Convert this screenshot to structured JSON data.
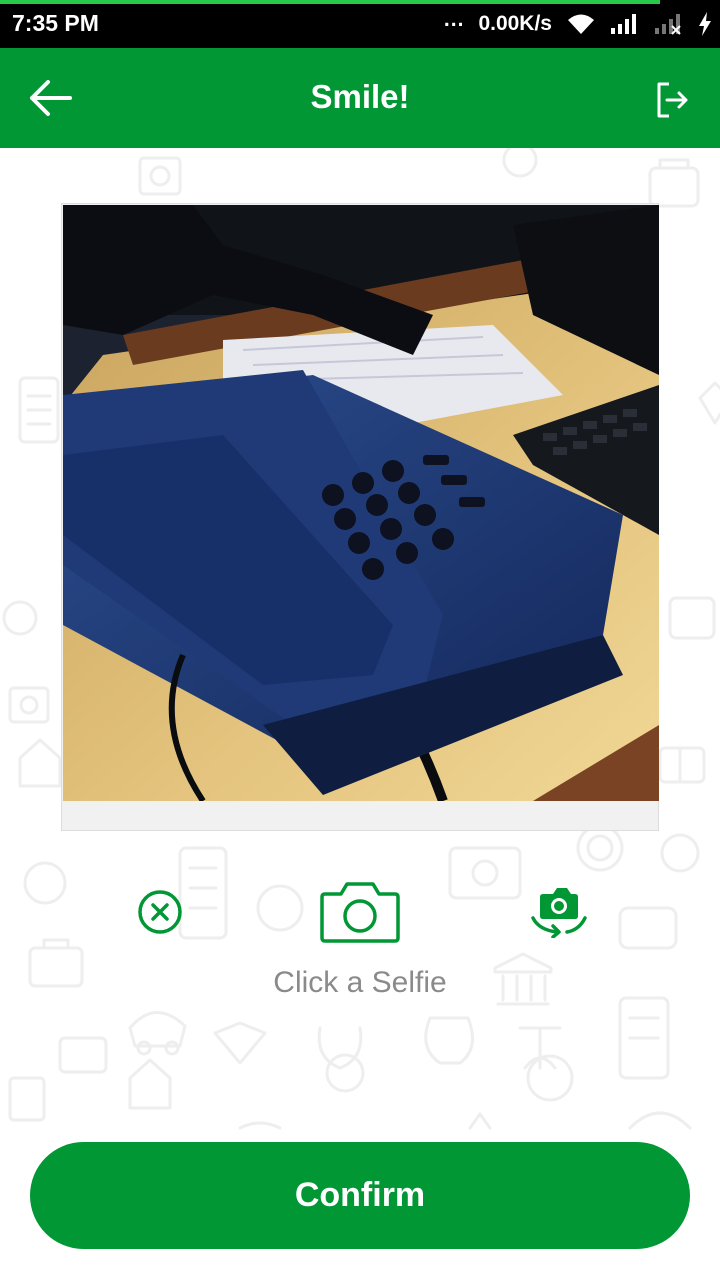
{
  "status_bar": {
    "time": "7:35 PM",
    "network_speed": "0.00K/s",
    "dots": "...",
    "icons": [
      "wifi-icon",
      "signal-icon",
      "signal-no-sim-icon",
      "charging-icon"
    ]
  },
  "app_bar": {
    "title": "Smile!",
    "back_icon": "arrow-left-icon",
    "logout_icon": "logout-icon"
  },
  "photo": {
    "description_icon": "captured-photo"
  },
  "controls": {
    "cancel_icon": "close-circle-icon",
    "capture_icon": "camera-icon",
    "switch_icon": "switch-camera-icon",
    "caption": "Click a Selfie"
  },
  "confirm": {
    "label": "Confirm"
  },
  "colors": {
    "brand_green": "#019734",
    "caption_gray": "#8a8a8a"
  }
}
